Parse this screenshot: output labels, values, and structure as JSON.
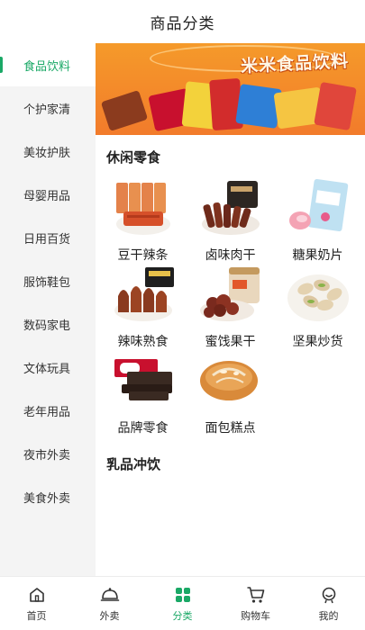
{
  "header": {
    "title": "商品分类"
  },
  "sidebar": {
    "items": [
      {
        "label": "食品饮料",
        "active": true
      },
      {
        "label": "个护家清"
      },
      {
        "label": "美妆护肤"
      },
      {
        "label": "母婴用品"
      },
      {
        "label": "日用百货"
      },
      {
        "label": "服饰鞋包"
      },
      {
        "label": "数码家电"
      },
      {
        "label": "文体玩具"
      },
      {
        "label": "老年用品"
      },
      {
        "label": "夜市外卖"
      },
      {
        "label": "美食外卖"
      }
    ]
  },
  "banner": {
    "title": "米米食品饮料"
  },
  "sections": [
    {
      "title": "休闲零食",
      "items": [
        {
          "label": "豆干辣条",
          "icon": "spicy-strips-image"
        },
        {
          "label": "卤味肉干",
          "icon": "beef-jerky-image"
        },
        {
          "label": "糖果奶片",
          "icon": "candy-image"
        },
        {
          "label": "辣味熟食",
          "icon": "duck-neck-image"
        },
        {
          "label": "蜜饯果干",
          "icon": "dried-fruit-image"
        },
        {
          "label": "坚果炒货",
          "icon": "pistachio-image"
        },
        {
          "label": "品牌零食",
          "icon": "kitkat-image"
        },
        {
          "label": "面包糕点",
          "icon": "bread-image"
        }
      ]
    },
    {
      "title": "乳品冲饮"
    }
  ],
  "tabbar": {
    "items": [
      {
        "label": "首页",
        "icon": "home-icon"
      },
      {
        "label": "外卖",
        "icon": "dome-icon"
      },
      {
        "label": "分类",
        "icon": "grid-icon",
        "active": true
      },
      {
        "label": "购物车",
        "icon": "cart-icon"
      },
      {
        "label": "我的",
        "icon": "user-icon"
      }
    ]
  },
  "colors": {
    "accent": "#1aa866",
    "sidebar_bg": "#f4f4f4",
    "banner": "#f27b2b"
  }
}
